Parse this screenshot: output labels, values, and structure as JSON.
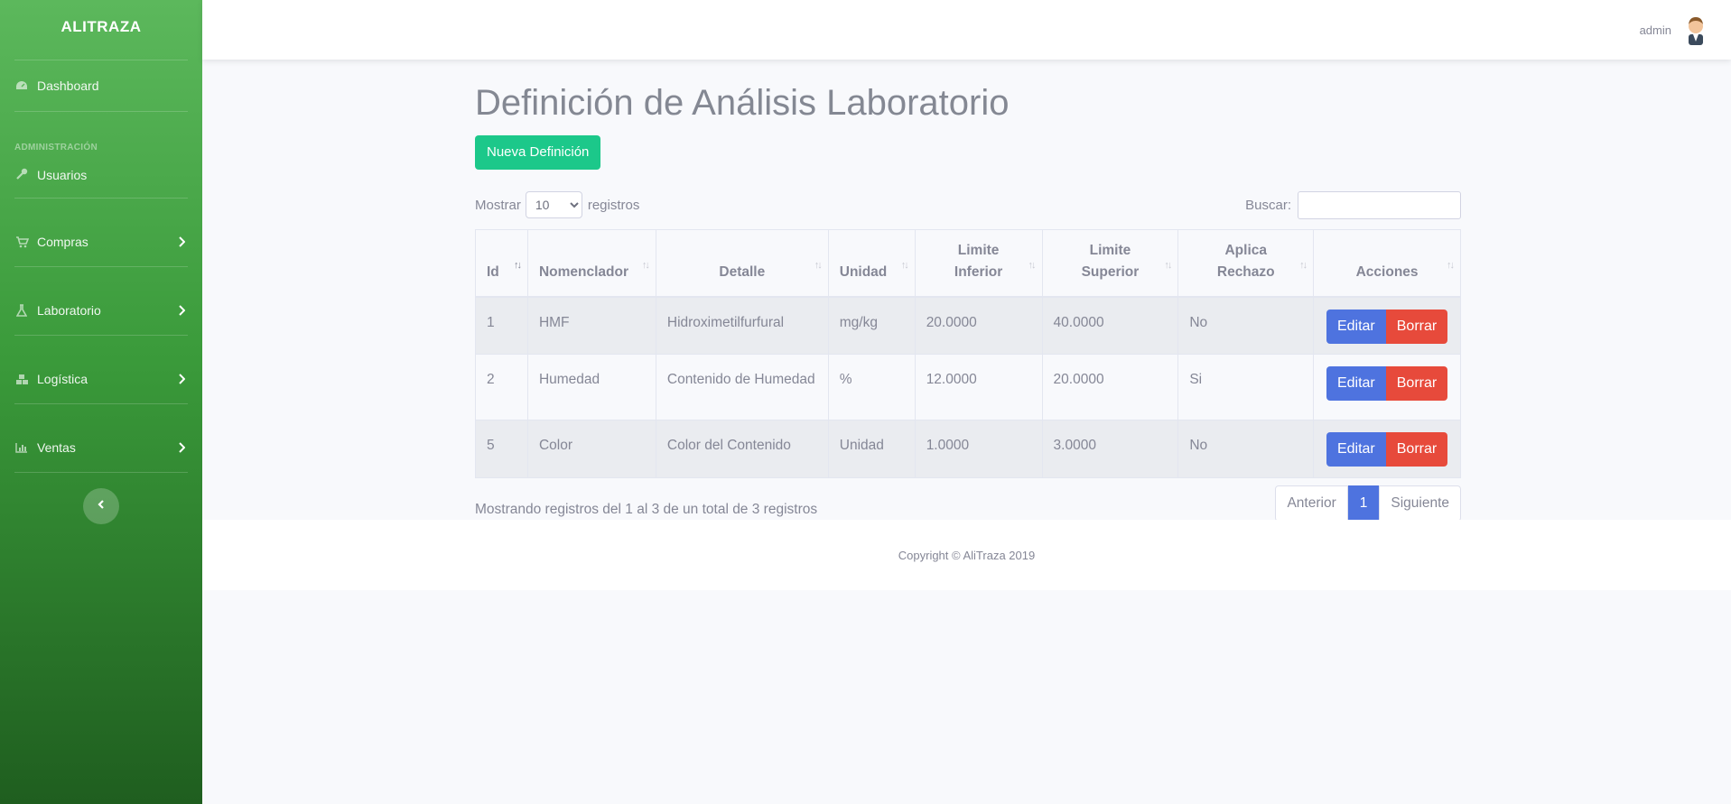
{
  "brand": "ALITRAZA",
  "sidebar": {
    "dashboard": "Dashboard",
    "heading": "ADMINISTRACIÓN",
    "items": [
      {
        "label": "Usuarios",
        "icon": "key-icon"
      },
      {
        "label": "Compras",
        "icon": "cart-icon"
      },
      {
        "label": "Laboratorio",
        "icon": "flask-icon"
      },
      {
        "label": "Logística",
        "icon": "cubes-icon"
      },
      {
        "label": "Ventas",
        "icon": "chart-icon"
      }
    ]
  },
  "topbar": {
    "user": "admin"
  },
  "main": {
    "title": "Definición de Análisis Laboratorio",
    "new_button": "Nueva Definición",
    "show_label": "Mostrar",
    "show_value": "10",
    "records_label": "registros",
    "search_label": "Buscar:",
    "search_value": ""
  },
  "table": {
    "columns": [
      "Id",
      "Nomenclador",
      "Detalle",
      "Unidad",
      "Limite Inferior",
      "Limite Superior",
      "Aplica Rechazo",
      "Acciones"
    ],
    "rows": [
      {
        "id": "1",
        "nomenclador": "HMF",
        "detalle": "Hidroximetilfurfural",
        "unidad": "mg/kg",
        "inferior": "20.0000",
        "superior": "40.0000",
        "rechazo": "No"
      },
      {
        "id": "2",
        "nomenclador": "Humedad",
        "detalle": "Contenido de Humedad",
        "unidad": "%",
        "inferior": "12.0000",
        "superior": "20.0000",
        "rechazo": "Si"
      },
      {
        "id": "5",
        "nomenclador": "Color",
        "detalle": "Color del Contenido",
        "unidad": "Unidad",
        "inferior": "1.0000",
        "superior": "3.0000",
        "rechazo": "No"
      }
    ],
    "edit_label": "Editar",
    "delete_label": "Borrar"
  },
  "pagination": {
    "info": "Mostrando registros del 1 al 3 de un total de 3 registros",
    "prev": "Anterior",
    "current": "1",
    "next": "Siguiente"
  },
  "footer": {
    "copyright": "Copyright © AliTraza 2019"
  }
}
